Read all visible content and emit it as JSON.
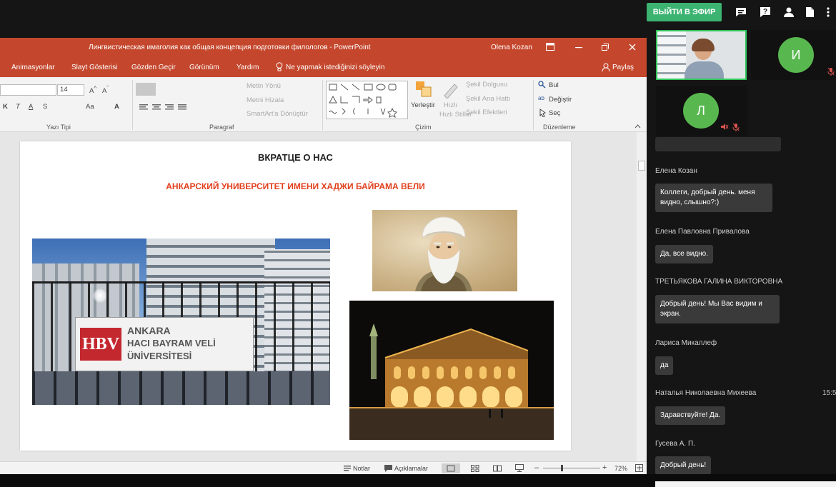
{
  "top_bar": {
    "live_button": "ВЫЙТИ В ЭФИР",
    "icons": [
      "chat-icon",
      "question-icon",
      "user-icon",
      "document-icon",
      "more-icon"
    ]
  },
  "powerpoint": {
    "title": "Лингвистическая имаголия как общая концепция подготовки филологов  -  PowerPoint",
    "user": "Olena Kozan",
    "menu": [
      "Animasyonlar",
      "Slayt Gösterisi",
      "Gözden Geçir",
      "Görünüm",
      "Yardım",
      "Ne yapmak istediğinizi söyleyin",
      "Paylaş"
    ],
    "ribbon": {
      "font_size": "14",
      "font_group": "Yazı Tipi",
      "paragraph_group": "Paragraf",
      "drawing_group": "Çizim",
      "editing_group": "Düzenleme",
      "text_direction": "Metin Yönü",
      "align_text": "Metni Hizala",
      "smartart": "SmartArt'a Dönüştür",
      "arrange": "Yerleştir",
      "quick_styles": "Hızlı Stiller",
      "shape_fill": "Şekil Dolgusu",
      "shape_outline": "Şekil Ana Hattı",
      "shape_effects": "Şekil Efektleri",
      "find": "Bul",
      "replace": "Değiştir",
      "select": "Seç"
    },
    "slide": {
      "title": "ВКРАТЦЕ О НАС",
      "subtitle": "АНКАРСКИЙ УНИВЕРСИТЕТ ИМЕНИ ХАДЖИ БАЙРАМА ВЕЛИ",
      "sign_line1": "ANKARA",
      "sign_line2": "HACI BAYRAM VELİ",
      "sign_line3": "ÜNİVERSİTESİ",
      "sign_logo": "HBV"
    },
    "status": {
      "notes": "Notlar",
      "comments": "Açıklamalar",
      "zoom": "72%"
    }
  },
  "participants": [
    {
      "initial": "И"
    },
    {
      "initial": "Л"
    }
  ],
  "chat": [
    {
      "name": "Елена Козан",
      "message_lines": [
        "Коллеги, добрый день. меня",
        "видно, слышно?:)"
      ]
    },
    {
      "name": "Елена Павловна Привалова",
      "message_lines": [
        "Да, все видно."
      ]
    },
    {
      "name": "ТРЕТЬЯКОВА ГАЛИНА ВИКТОРОВНА",
      "message_lines": [
        "Добрый день! Мы Вас видим и",
        "экран."
      ]
    },
    {
      "name": "Лариса Микаллеф",
      "message_lines": [
        "да"
      ]
    },
    {
      "name": "Наталья Николаевна Михеева",
      "time": "15:5",
      "message_lines": [
        "Здравствуйте! Да."
      ]
    },
    {
      "name": "Гусева А. П.",
      "message_lines": [
        "Добрый день!"
      ]
    }
  ],
  "colors": {
    "ppt_accent": "#c4472d",
    "live_button": "#3cb371",
    "avatar": "#58b84f",
    "slide_subtitle": "#e2401d"
  }
}
